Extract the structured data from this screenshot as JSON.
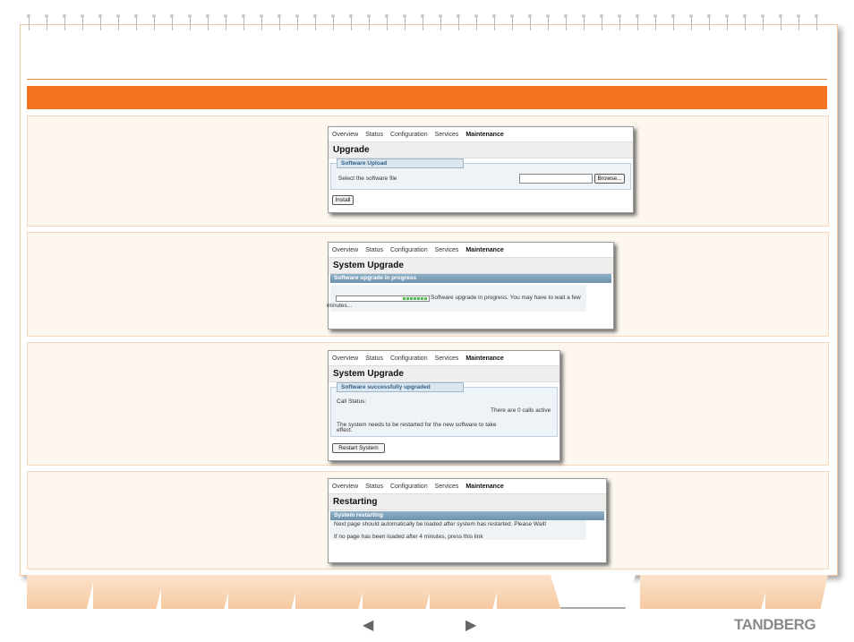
{
  "nav": [
    "Overview",
    "Status",
    "Configuration",
    "Services",
    "Maintenance"
  ],
  "panel1": {
    "title": "Upgrade",
    "legend": "Software Upload",
    "label": "Select the software file",
    "browse": "Browse...",
    "install": "Install"
  },
  "panel2": {
    "title": "System Upgrade",
    "bar": "Software upgrade in progress",
    "msg1": "Software upgrade in progress. You may have to wait a few",
    "msg2": "minutes..."
  },
  "panel3": {
    "title": "System Upgrade",
    "legend": "Software successfully upgraded",
    "call_label": "Call Status:",
    "call_value": "There are 0 calls active",
    "restart_text1": "The system needs to be restarted for the new software to take",
    "restart_text2": "effect.",
    "restart_button": "Restart System"
  },
  "panel4": {
    "title": "Restarting",
    "bar": "System restarting",
    "msg1": "Next page should automatically be loaded after system has restarted. Please Wait!",
    "msg2": "If no page has been loaded after 4 minutes, press this link"
  },
  "footer": {
    "prev": "◀",
    "next": "▶",
    "logo": "TANDBERG"
  },
  "colors": {
    "accent": "#f47321"
  }
}
